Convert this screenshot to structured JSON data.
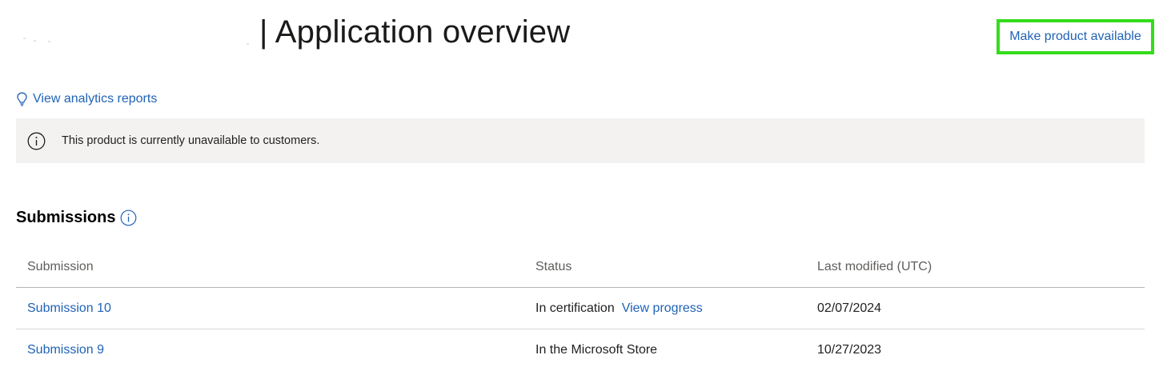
{
  "header": {
    "title": "| Application overview",
    "action_label": "Make product available"
  },
  "analytics_link": {
    "label": "View analytics reports",
    "icon": "lightbulb-icon"
  },
  "banner": {
    "icon": "info-icon",
    "text": "This product is currently unavailable to customers."
  },
  "submissions": {
    "heading": "Submissions",
    "help_icon": "info-icon",
    "columns": [
      "Submission",
      "Status",
      "Last modified (UTC)"
    ],
    "rows": [
      {
        "name": "Submission 10",
        "status": "In certification",
        "status_link": "View progress",
        "modified": "02/07/2024"
      },
      {
        "name": "Submission 9",
        "status": "In the Microsoft Store",
        "status_link": "",
        "modified": "10/27/2023"
      }
    ]
  },
  "colors": {
    "link": "#2063b6",
    "highlight_border": "#33dd1c",
    "banner_bg": "#f3f2f1"
  }
}
